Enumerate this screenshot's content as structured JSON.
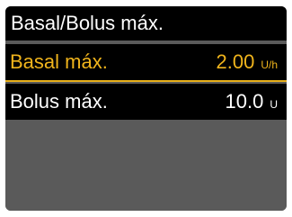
{
  "title": "Basal/Bolus máx.",
  "colors": {
    "highlight": "#f0b41c",
    "background": "#000000",
    "empty_area": "#5a5a5a"
  },
  "rows": [
    {
      "label": "Basal máx.",
      "value": "2.00",
      "unit": "U/h",
      "selected": true
    },
    {
      "label": "Bolus máx.",
      "value": "10.0",
      "unit": "U",
      "selected": false
    }
  ]
}
